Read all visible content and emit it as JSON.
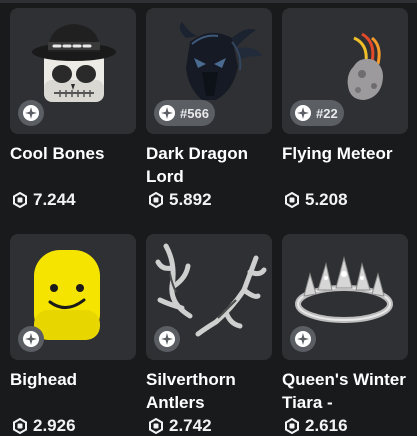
{
  "items": [
    {
      "name": "Cool Bones",
      "price": "7.244",
      "serial": "",
      "icon": "skull-fedora-hat"
    },
    {
      "name": "Dark Dragon Lord",
      "price": "5.892",
      "serial": "#566",
      "icon": "dragon-helmet"
    },
    {
      "name": "Flying Meteor",
      "price": "5.208",
      "serial": "#22",
      "icon": "meteor"
    },
    {
      "name": "Bighead",
      "price": "2.926",
      "serial": "",
      "icon": "yellow-bighead"
    },
    {
      "name": "Silverthorn Antlers",
      "price": "2.742",
      "serial": "",
      "icon": "silver-antlers"
    },
    {
      "name": "Queen's Winter Tiara -",
      "price": "2.616",
      "serial": "",
      "icon": "silver-tiara"
    }
  ],
  "colors": {
    "background": "#191a1c",
    "card": "#2e3033",
    "badge": "#5b5e63",
    "text": "#ffffff"
  },
  "icons": {
    "limited": "limited-sparkle-icon",
    "currency": "robux-icon"
  }
}
